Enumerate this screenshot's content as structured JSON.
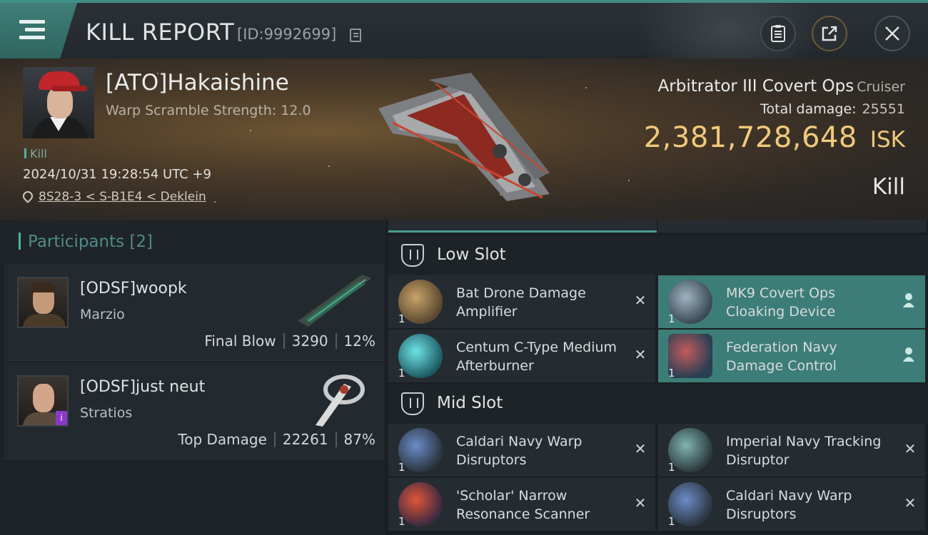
{
  "header": {
    "title": "KILL REPORT",
    "report_id": "[ID:9992699]",
    "icons": {
      "menu": "hamburger-icon",
      "copy": "copy-icon",
      "clipboard": "clipboard-icon",
      "share": "share-icon",
      "close": "close-icon"
    },
    "accent_color": "#3f8f86"
  },
  "victim": {
    "name": "[ATO]Hakaishine",
    "warp_scramble": "Warp Scramble Strength: 12.0",
    "tag": "Kill",
    "datetime": "2024/10/31 19:28:54 UTC +9",
    "location": "8S28-3 < S-B1E4 < Deklein",
    "ship_name": "Arbitrator III Covert Ops",
    "ship_class": "Cruiser",
    "total_damage_label": "Total damage:",
    "total_damage": "25551",
    "isk_value": "2,381,728,648",
    "isk_unit": "ISK",
    "result": "Kill",
    "isk_color": "#f0c97a"
  },
  "participants": {
    "title": "Participants",
    "count": "[2]",
    "items": [
      {
        "name": "[ODSF]woopk",
        "ship": "Marzio",
        "role": "Final Blow",
        "damage": "3290",
        "percent": "12%"
      },
      {
        "name": "[ODSF]just neut",
        "ship": "Stratios",
        "role": "Top Damage",
        "damage": "22261",
        "percent": "87%"
      }
    ]
  },
  "fitting": {
    "low_slot": {
      "label": "Low Slot",
      "modules": [
        {
          "name": "Bat Drone Damage Amplifier",
          "qty": "1",
          "highlighted": false
        },
        {
          "name": "MK9 Covert Ops Cloaking Device",
          "qty": "1",
          "highlighted": true
        },
        {
          "name": "Centum C-Type Medium Afterburner",
          "qty": "1",
          "highlighted": false
        },
        {
          "name": "Federation Navy Damage Control",
          "qty": "1",
          "highlighted": true
        }
      ]
    },
    "mid_slot": {
      "label": "Mid Slot",
      "modules": [
        {
          "name": "Caldari Navy Warp Disruptors",
          "qty": "1",
          "highlighted": false
        },
        {
          "name": "Imperial Navy Tracking Disruptor",
          "qty": "1",
          "highlighted": false
        },
        {
          "name": "'Scholar' Narrow Resonance Scanner",
          "qty": "1",
          "highlighted": false
        },
        {
          "name": "Caldari Navy Warp Disruptors",
          "qty": "1",
          "highlighted": false
        }
      ]
    },
    "top_stub_qty": [
      "1",
      "1"
    ]
  }
}
